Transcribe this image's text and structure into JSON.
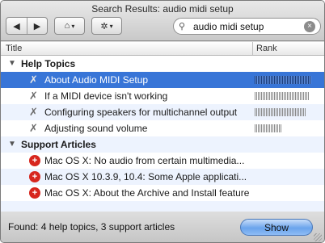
{
  "window": {
    "title": "Search Results: audio midi setup"
  },
  "toolbar": {
    "back_glyph": "◀",
    "forward_glyph": "▶",
    "home_glyph": "⌂",
    "gear_glyph": "✲",
    "caret_glyph": "▾"
  },
  "search": {
    "value": "audio midi setup",
    "glass_glyph": "⚲",
    "clear_glyph": "×"
  },
  "columns": {
    "title": "Title",
    "rank": "Rank"
  },
  "groups": [
    {
      "label": "Help Topics",
      "disclosure": "▼",
      "items": [
        {
          "label": "About Audio MIDI Setup",
          "icon_glyph": "✗",
          "rank": 0.95,
          "selected": true
        },
        {
          "label": "If a MIDI device isn't working",
          "icon_glyph": "✗",
          "rank": 0.92,
          "selected": false
        },
        {
          "label": "Configuring speakers for multichannel output",
          "icon_glyph": "✗",
          "rank": 0.87,
          "selected": false
        },
        {
          "label": "Adjusting sound volume",
          "icon_glyph": "✗",
          "rank": 0.45,
          "selected": false
        }
      ]
    },
    {
      "label": "Support Articles",
      "disclosure": "▼",
      "items": [
        {
          "label": "Mac OS X: No audio from certain multimedia...",
          "icon_glyph": "+"
        },
        {
          "label": "Mac OS X 10.3.9, 10.4: Some Apple applicati...",
          "icon_glyph": "+"
        },
        {
          "label": "Mac OS X: About the Archive and Install feature",
          "icon_glyph": "+"
        }
      ]
    }
  ],
  "status": {
    "text": "Found: 4 help topics, 3 support articles",
    "show_label": "Show"
  },
  "colors": {
    "selection": "#3875d7",
    "alt_row": "#edf3fe",
    "support_icon": "#d7261e"
  }
}
